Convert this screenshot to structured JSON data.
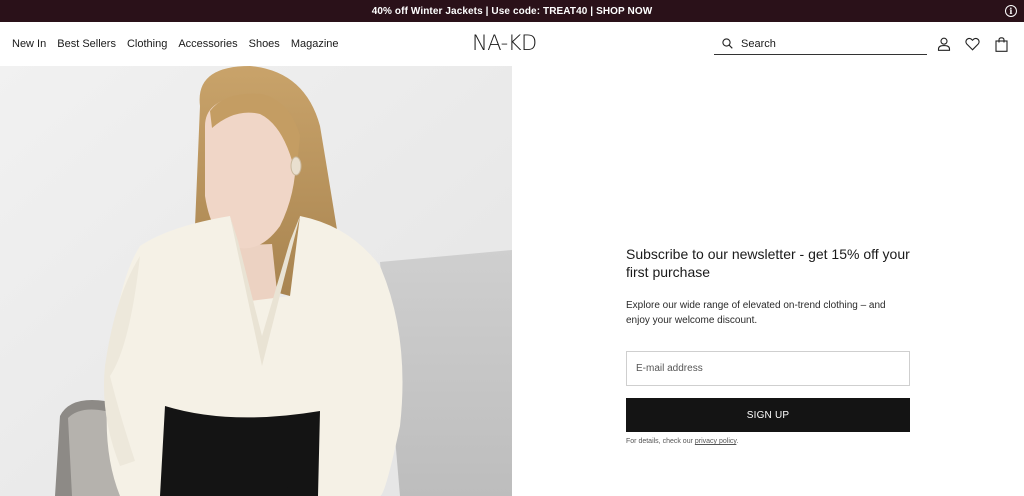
{
  "promo": {
    "text": "40% off Winter Jackets | Use code: TREAT40 | SHOP NOW",
    "info_icon": "info-icon"
  },
  "nav": {
    "items": [
      {
        "label": "New In"
      },
      {
        "label": "Best Sellers"
      },
      {
        "label": "Clothing"
      },
      {
        "label": "Accessories"
      },
      {
        "label": "Shoes"
      },
      {
        "label": "Magazine"
      }
    ]
  },
  "logo": "NA-KD",
  "search": {
    "placeholder": "Search"
  },
  "header_icons": [
    "user-icon",
    "heart-icon",
    "bag-icon"
  ],
  "newsletter": {
    "title": "Subscribe to our newsletter - get 15% off your first purchase",
    "description": "Explore our wide range of elevated on-trend clothing – and enjoy your welcome discount.",
    "email_placeholder": "E-mail address",
    "button": "SIGN UP",
    "fine_print": "For details, check our",
    "privacy_link": "privacy policy",
    "fine_print_end": "."
  },
  "colors": {
    "promo_bg": "#2a1119",
    "button_bg": "#141414"
  }
}
